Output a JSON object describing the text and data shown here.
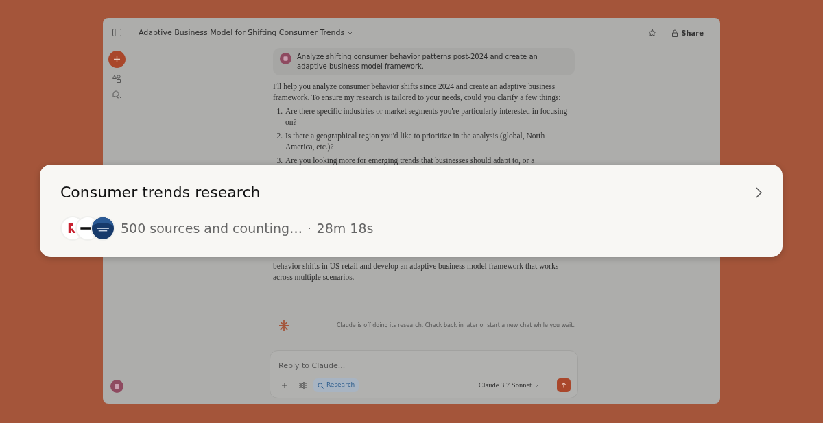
{
  "window": {
    "title": "Adaptive Business Model for Shifting Consumer Trends",
    "share_label": "Share"
  },
  "user_message": "Analyze shifting consumer behavior patterns post-2024 and create an adaptive business model framework.",
  "response": {
    "intro": "I'll help you analyze consumer behavior shifts since 2024 and create an adaptive business framework. To ensure my research is tailored to your needs, could you clarify a few things:",
    "questions": [
      {
        "number": "1.",
        "text": "Are there specific industries or market segments you're particularly interested in focusing on?"
      },
      {
        "number": "2.",
        "text": "Is there a geographical region you'd like to prioritize in the analysis (global, North America, etc.)?"
      },
      {
        "number": "3.",
        "text": "Are you looking more for emerging trends that businesses should adapt to, or a"
      }
    ],
    "closing": "behavior shifts in US retail and develop an adaptive business model framework that works across multiple scenarios."
  },
  "status_note": "Claude is off doing its research. Check back in later or start a new chat while you wait.",
  "composer": {
    "placeholder": "Reply to Claude...",
    "tools": [
      {
        "label": "Research",
        "selected": true
      }
    ],
    "model": "Claude 3.7 Sonnet"
  },
  "research_card": {
    "title": "Consumer trends research",
    "progress": "500 sources and counting…",
    "separator": "·",
    "elapsed": "28m 18s"
  }
}
